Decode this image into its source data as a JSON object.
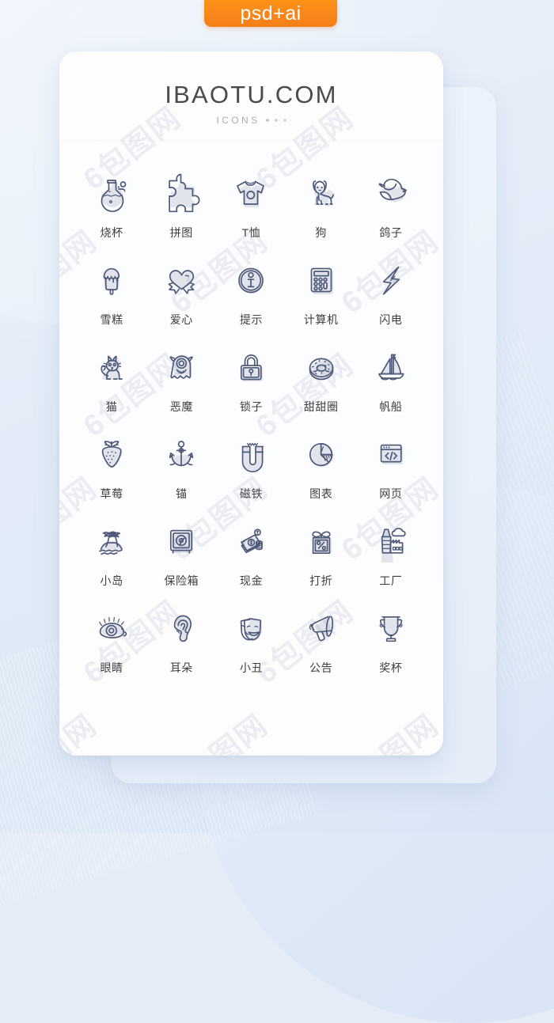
{
  "badge": {
    "label": "psd+ai",
    "color": "#f8861a"
  },
  "card": {
    "title": "IBAOTU.COM",
    "subtitle": "ICONS",
    "title_color": "#4a4a4a",
    "subtitle_color": "#adadad",
    "background": "#fdfdfe"
  },
  "theme": {
    "page_background": "#e4ecf8",
    "icon_stroke": "#4e5878",
    "icon_shade": "#dcdfe6",
    "label_color": "#3e3e3e"
  },
  "watermark": {
    "text": "6包图网"
  },
  "icons": [
    {
      "label": "烧杯",
      "name": "beaker-icon"
    },
    {
      "label": "拼图",
      "name": "puzzle-icon"
    },
    {
      "label": "T恤",
      "name": "tshirt-icon"
    },
    {
      "label": "狗",
      "name": "dog-icon"
    },
    {
      "label": "鸽子",
      "name": "dove-icon"
    },
    {
      "label": "雪糕",
      "name": "ice-cream-icon"
    },
    {
      "label": "爱心",
      "name": "heart-icon"
    },
    {
      "label": "提示",
      "name": "info-icon"
    },
    {
      "label": "计算机",
      "name": "calculator-icon"
    },
    {
      "label": "闪电",
      "name": "lightning-icon"
    },
    {
      "label": "猫",
      "name": "cat-icon"
    },
    {
      "label": "恶魔",
      "name": "devil-icon"
    },
    {
      "label": "锁子",
      "name": "lock-icon"
    },
    {
      "label": "甜甜圈",
      "name": "donut-icon"
    },
    {
      "label": "帆船",
      "name": "sailboat-icon"
    },
    {
      "label": "草莓",
      "name": "strawberry-icon"
    },
    {
      "label": "锚",
      "name": "anchor-icon"
    },
    {
      "label": "磁铁",
      "name": "magnet-icon"
    },
    {
      "label": "图表",
      "name": "pie-chart-icon"
    },
    {
      "label": "网页",
      "name": "webpage-code-icon"
    },
    {
      "label": "小岛",
      "name": "island-icon"
    },
    {
      "label": "保险箱",
      "name": "safe-icon"
    },
    {
      "label": "现金",
      "name": "cash-icon"
    },
    {
      "label": "打折",
      "name": "discount-tag-icon"
    },
    {
      "label": "工厂",
      "name": "factory-icon"
    },
    {
      "label": "眼睛",
      "name": "eye-icon"
    },
    {
      "label": "耳朵",
      "name": "ear-icon"
    },
    {
      "label": "小丑",
      "name": "theater-masks-icon"
    },
    {
      "label": "公告",
      "name": "megaphone-icon"
    },
    {
      "label": "奖杯",
      "name": "trophy-icon"
    }
  ]
}
